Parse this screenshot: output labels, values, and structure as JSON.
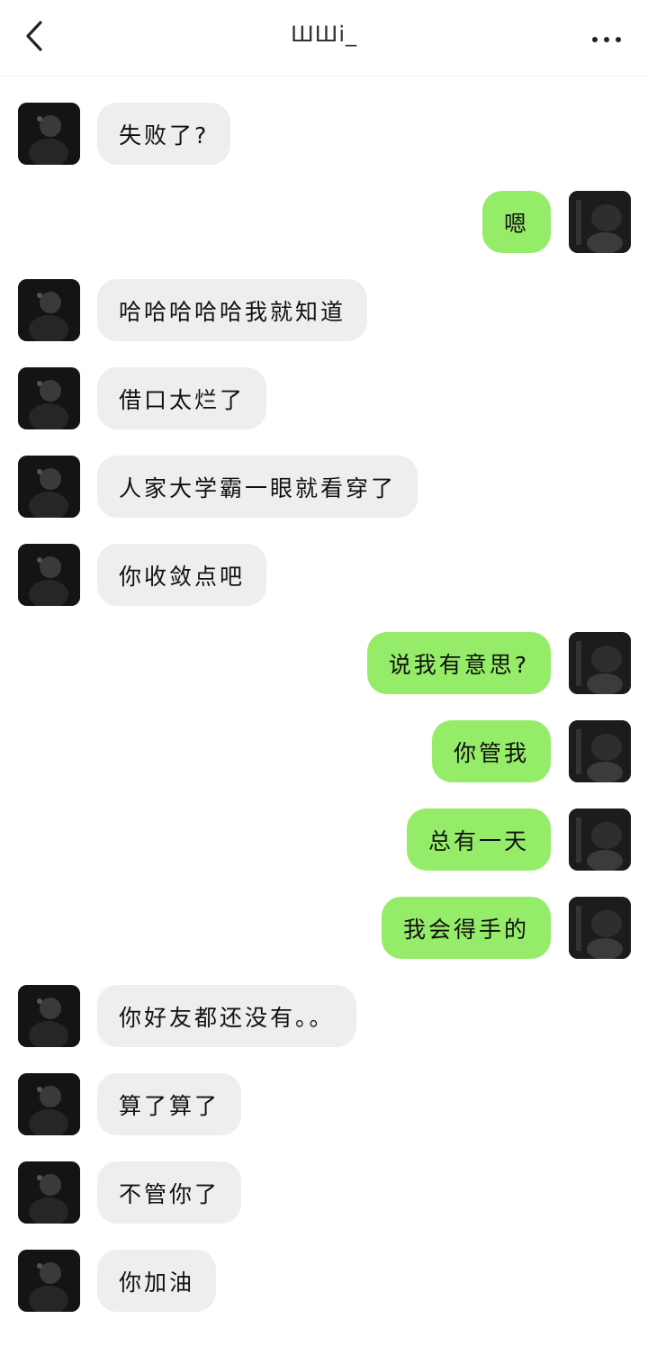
{
  "header": {
    "title": "ШШі_",
    "back_icon": "chevron-left-icon",
    "more_icon": "more-dots-icon"
  },
  "colors": {
    "incoming_bubble": "#eeeeee",
    "outgoing_bubble": "#95ec69"
  },
  "messages": [
    {
      "side": "left",
      "text": "失败了?"
    },
    {
      "side": "right",
      "text": "嗯"
    },
    {
      "side": "left",
      "text": "哈哈哈哈哈我就知道"
    },
    {
      "side": "left",
      "text": "借口太烂了"
    },
    {
      "side": "left",
      "text": "人家大学霸一眼就看穿了"
    },
    {
      "side": "left",
      "text": "你收敛点吧"
    },
    {
      "side": "right",
      "text": "说我有意思?"
    },
    {
      "side": "right",
      "text": "你管我"
    },
    {
      "side": "right",
      "text": "总有一天"
    },
    {
      "side": "right",
      "text": "我会得手的"
    },
    {
      "side": "left",
      "text": "你好友都还没有。。"
    },
    {
      "side": "left",
      "text": "算了算了"
    },
    {
      "side": "left",
      "text": "不管你了"
    },
    {
      "side": "left",
      "text": "你加油"
    }
  ]
}
